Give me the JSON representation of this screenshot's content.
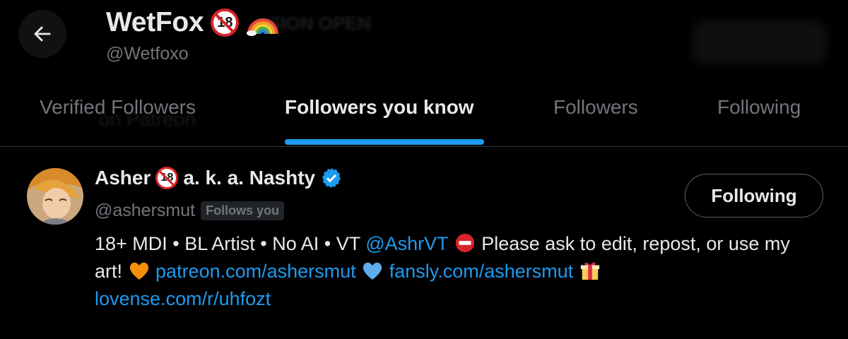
{
  "header": {
    "name": "WetFox",
    "handle": "@Wetfoxo",
    "age_badge": "18",
    "banner_ghost_text": "SION OPEN"
  },
  "tabs": [
    {
      "label": "Verified Followers",
      "active": false
    },
    {
      "label": "Followers you know",
      "active": true
    },
    {
      "label": "Followers",
      "active": false
    },
    {
      "label": "Following",
      "active": false
    }
  ],
  "tab_ghost_text": "on Patreon",
  "user": {
    "name_prefix": "Asher",
    "age_badge": "18",
    "name_suffix": "a. k. a. Nashty",
    "handle": "@ashersmut",
    "follows_you": "Follows you",
    "button_label": "Following",
    "bio": {
      "part1": "18+ MDI • BL Artist • No AI • VT ",
      "mention": "@AshrVT",
      "part2": " Please ask to edit, repost, or use my art! ",
      "link1": "patreon.com/ashersmut",
      "link2": "fansly.com/ashersmut",
      "link3": "lovense.com/r/uhfozt"
    }
  },
  "colors": {
    "background": "#000000",
    "accent": "#1d9bf0",
    "text_primary": "#e7e9ea",
    "text_secondary": "#71767b",
    "badge_red": "#d8232a"
  },
  "icons": [
    "back-arrow-icon",
    "rainbow-icon",
    "age-18-icon",
    "verified-badge-icon",
    "no-entry-icon",
    "orange-heart-icon",
    "blue-heart-icon",
    "gift-icon"
  ]
}
